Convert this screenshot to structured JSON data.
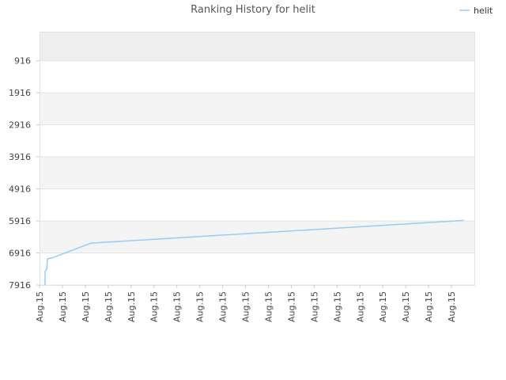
{
  "chart_data": {
    "type": "line",
    "title": "Ranking History for helit",
    "xlabel": "",
    "ylabel": "",
    "y_inverted": true,
    "ylim": [
      8,
      7916
    ],
    "yticks": [
      916,
      1916,
      2916,
      3916,
      4916,
      5916,
      6916,
      7916
    ],
    "x_tick_labels": [
      "Aug.15",
      "Aug.15",
      "Aug.15",
      "Aug.15",
      "Aug.15",
      "Aug.15",
      "Aug.15",
      "Aug.15",
      "Aug.15",
      "Aug.15",
      "Aug.15",
      "Aug.15",
      "Aug.15",
      "Aug.15",
      "Aug.15",
      "Aug.15",
      "Aug.15",
      "Aug.15",
      "Aug.15"
    ],
    "grid": true,
    "legend_position": "top-right",
    "series": [
      {
        "name": "helit",
        "color": "#99ccf2",
        "x": [
          0,
          0,
          0.08,
          0.1,
          0.3,
          2.0,
          18.3
        ],
        "y": [
          7916,
          7500,
          7400,
          7100,
          7070,
          6610,
          5900
        ]
      }
    ]
  }
}
